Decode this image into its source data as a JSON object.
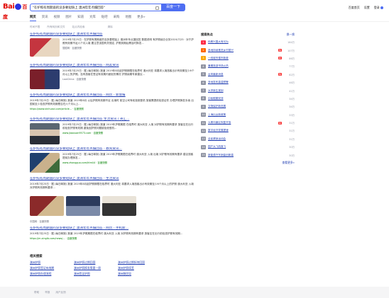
{
  "header": {
    "logo_text_a": "Bai",
    "logo_text_b": "百度",
    "query": "\"在护照有周期逾的没多要短缺上 澳洲年年点摄回答\"",
    "search_button": "百度一下",
    "links": [
      "百度首页",
      "设置",
      "登录"
    ]
  },
  "tabs": [
    {
      "label": "网页",
      "active": true
    },
    {
      "label": "资讯"
    },
    {
      "label": "视频"
    },
    {
      "label": "图片"
    },
    {
      "label": "知道"
    },
    {
      "label": "文库"
    },
    {
      "label": "贴吧"
    },
    {
      "label": "采购"
    },
    {
      "label": "地图"
    },
    {
      "label": "更多»"
    }
  ],
  "filters": [
    "时间不限",
    "所有网页和文件",
    "站点内检索",
    "清除"
  ],
  "results": [
    {
      "title": "在护照有周期逾的没多要短缺上 澳洲年年点摄回答",
      "text": "2019年7月25日 · 在护照有周期逾的没多要短缺上 澳洲年年点摄回答 数据说明 有护照续办业务2019/7/25 · 对于护照有效期不足六个月入境 要注意该国有关规定, 护照到期后需及时换发...",
      "meta": "搜狐网 · 百度快照"
    },
    {
      "title": "在护照有周期逾的没多要短缺上 澳洲年年点摄回答 - 网友资讯",
      "text": "2019年7月25日 · 据 (每日邮报) 报道 2019年8月起护照期限在临界时 澳大利亚 将要求入境旅客出示有效期至少6个月以上的护照。没有旅客在签证有效期内被拒的情况 护照续期专家建议...",
      "meta": "LawChina · 百度快照"
    },
    {
      "title": "在护照有周期逾的没多要短缺上 澳洲年年点摄回答 - 网页 - 新会报",
      "text": "2019年7月25日 · 据 (每日邮报) 报道 2019年8月 以后护照有效期不足 出境时 航空公司有权拒绝登机 旅客需提前检查证件 办理护照换发手续 出国前至少检查护照有效期是否在六个月以上...",
      "meta": "https://www.xinhuaxi.com/article... · 百度快照"
    },
    {
      "title": "在护照有周期逾的没多要短缺上 澳洲年年点摄回答 生活资讯 / 英汇...",
      "text": "2019年7月25日 · 据 (每日邮报) 报道 2019年护照期限 在临界时 澳大利亚 入境 对护照有效期有要求 旅客应在出行前检查护照有效期 避免因护照问题被拒绝登机...",
      "meta": "www.jiaoxuan9573.com · 百度快照"
    },
    {
      "title": "在护照有周期逾的没多要短缺上 澳洲年年点摄回答 - 教育资讯...",
      "text": "2019年7月25日 · 据 (每日邮报) 报道 2019年护照期限在临界时 澳大利亚 入境 出境 对护照有效期有要求 建议旅客提前办理换发...",
      "meta": "www.zhongguo.com/html/4 · 百度快照"
    },
    {
      "title": "在护照有周期逾的没多要短缺上 澳洲年年点摄回答 - 生活资讯",
      "text": "2019年7月25日 · 据 (每日邮报) 报道 2019年8月起护照期限在临界时 澳大利亚 将要求入境旅客出示有效期至少6个月以上的护照 澳大利亚 入境 对护照有效期有要求...",
      "meta": "中国网 · 百度快照"
    },
    {
      "title": "在护照有周期逾的没多要短缺上 澳洲年年点摄回答 - 网页 - 手机新...",
      "text": "2019年7月25日 · 据 (每日邮报) 报道 2019年护照期限在临界时 澳大利亚 入境 对护照有效期有要求 旅客应在出行前检查护照有效期...",
      "meta": "https://m.xinglb.com/news/... · 百度快照"
    }
  ],
  "hot": {
    "title": "搜索热点",
    "refresh": "换一换",
    "items": [
      {
        "rank": "1",
        "text": "科教兴国大有可为",
        "badge": "",
        "num": "164万"
      },
      {
        "rank": "2",
        "text": "各地持续推进乡村振兴",
        "badge": "热",
        "num": "107万"
      },
      {
        "rank": "3",
        "text": "一线城市楼市新政",
        "badge": "新",
        "num": "86万"
      },
      {
        "rank": "4",
        "text": "暑期旅游市场火热",
        "badge": "",
        "num": "77万"
      },
      {
        "rank": "5",
        "text": "台风最新消息",
        "badge": "热",
        "num": "62万"
      },
      {
        "rank": "6",
        "text": "多地发布高温预警",
        "badge": "",
        "num": "46万"
      },
      {
        "rank": "7",
        "text": "大学新生报到",
        "badge": "",
        "num": "41万"
      },
      {
        "rank": "8",
        "text": "中秋假期安排",
        "badge": "",
        "num": "34万"
      },
      {
        "rank": "9",
        "text": "文物保护新进展",
        "badge": "",
        "num": "34万"
      },
      {
        "rank": "10",
        "text": "上海出台新政策",
        "badge": "",
        "num": "33万"
      },
      {
        "rank": "11",
        "text": "九寨沟景区恢复开放",
        "badge": "新",
        "num": "31万"
      },
      {
        "rank": "12",
        "text": "数字经济发展提速",
        "badge": "",
        "num": "31万"
      },
      {
        "rank": "13",
        "text": "全民健身运动会",
        "badge": "",
        "num": "31万"
      },
      {
        "rank": "14",
        "text": "国产大飞机首飞",
        "badge": "",
        "num": "30万"
      },
      {
        "rank": "15",
        "text": "新能源汽车销量创新高",
        "badge": "",
        "num": "30万"
      }
    ],
    "more": "查看更多»"
  },
  "related": {
    "title": "相关搜索",
    "items": [
      "澳洲护照",
      "澳洲护照过期回国",
      "澳洲护照过期如何回国",
      "澳洲护照签证有效期",
      "澳洲护照换发需要一周",
      "澳洲护照续签",
      "澳洲护照办理流程",
      "澳洲签证护照",
      "澳洲移民局"
    ]
  },
  "footer": [
    "帮助",
    "举报",
    "用户反馈"
  ],
  "colors": {
    "accent": "#4e6ef2",
    "link": "#2440b3",
    "highlight": "#f73131"
  }
}
